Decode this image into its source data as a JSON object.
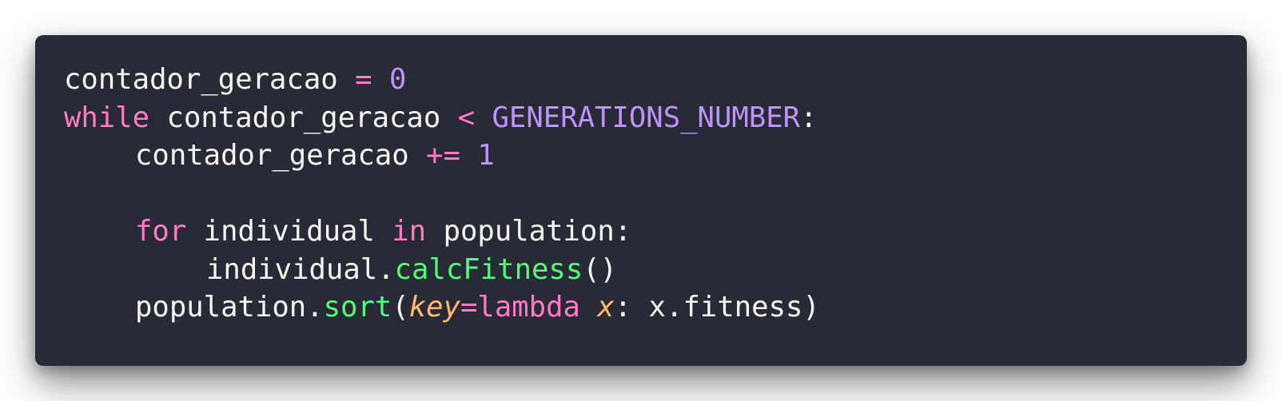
{
  "code": {
    "language": "python",
    "theme_colors": {
      "background": "#282a36",
      "plain": "#f8f8f2",
      "keyword": "#ff79c6",
      "number": "#bd93f9",
      "function": "#50fa7b",
      "parameter": "#ffb86c"
    },
    "lines": [
      {
        "indent": 0,
        "tokens": [
          {
            "text": "contador_geracao ",
            "type": "plain"
          },
          {
            "text": "=",
            "type": "op"
          },
          {
            "text": " ",
            "type": "plain"
          },
          {
            "text": "0",
            "type": "num"
          }
        ]
      },
      {
        "indent": 0,
        "tokens": [
          {
            "text": "while",
            "type": "kw"
          },
          {
            "text": " contador_geracao ",
            "type": "plain"
          },
          {
            "text": "<",
            "type": "op"
          },
          {
            "text": " ",
            "type": "plain"
          },
          {
            "text": "GENERATIONS_NUMBER",
            "type": "const"
          },
          {
            "text": ":",
            "type": "plain"
          }
        ]
      },
      {
        "indent": 1,
        "tokens": [
          {
            "text": "contador_geracao ",
            "type": "plain"
          },
          {
            "text": "+=",
            "type": "op"
          },
          {
            "text": " ",
            "type": "plain"
          },
          {
            "text": "1",
            "type": "num"
          }
        ]
      },
      {
        "indent": 0,
        "tokens": []
      },
      {
        "indent": 1,
        "tokens": [
          {
            "text": "for",
            "type": "kw"
          },
          {
            "text": " individual ",
            "type": "plain"
          },
          {
            "text": "in",
            "type": "kw"
          },
          {
            "text": " population:",
            "type": "plain"
          }
        ]
      },
      {
        "indent": 2,
        "tokens": [
          {
            "text": "individual.",
            "type": "plain"
          },
          {
            "text": "calcFitness",
            "type": "fn"
          },
          {
            "text": "()",
            "type": "plain"
          }
        ]
      },
      {
        "indent": 1,
        "tokens": [
          {
            "text": "population.",
            "type": "plain"
          },
          {
            "text": "sort",
            "type": "fn"
          },
          {
            "text": "(",
            "type": "plain"
          },
          {
            "text": "key",
            "type": "param"
          },
          {
            "text": "=",
            "type": "op"
          },
          {
            "text": "lambda",
            "type": "kw"
          },
          {
            "text": " ",
            "type": "plain"
          },
          {
            "text": "x",
            "type": "param"
          },
          {
            "text": ": x.fitness)",
            "type": "plain"
          }
        ]
      }
    ]
  }
}
